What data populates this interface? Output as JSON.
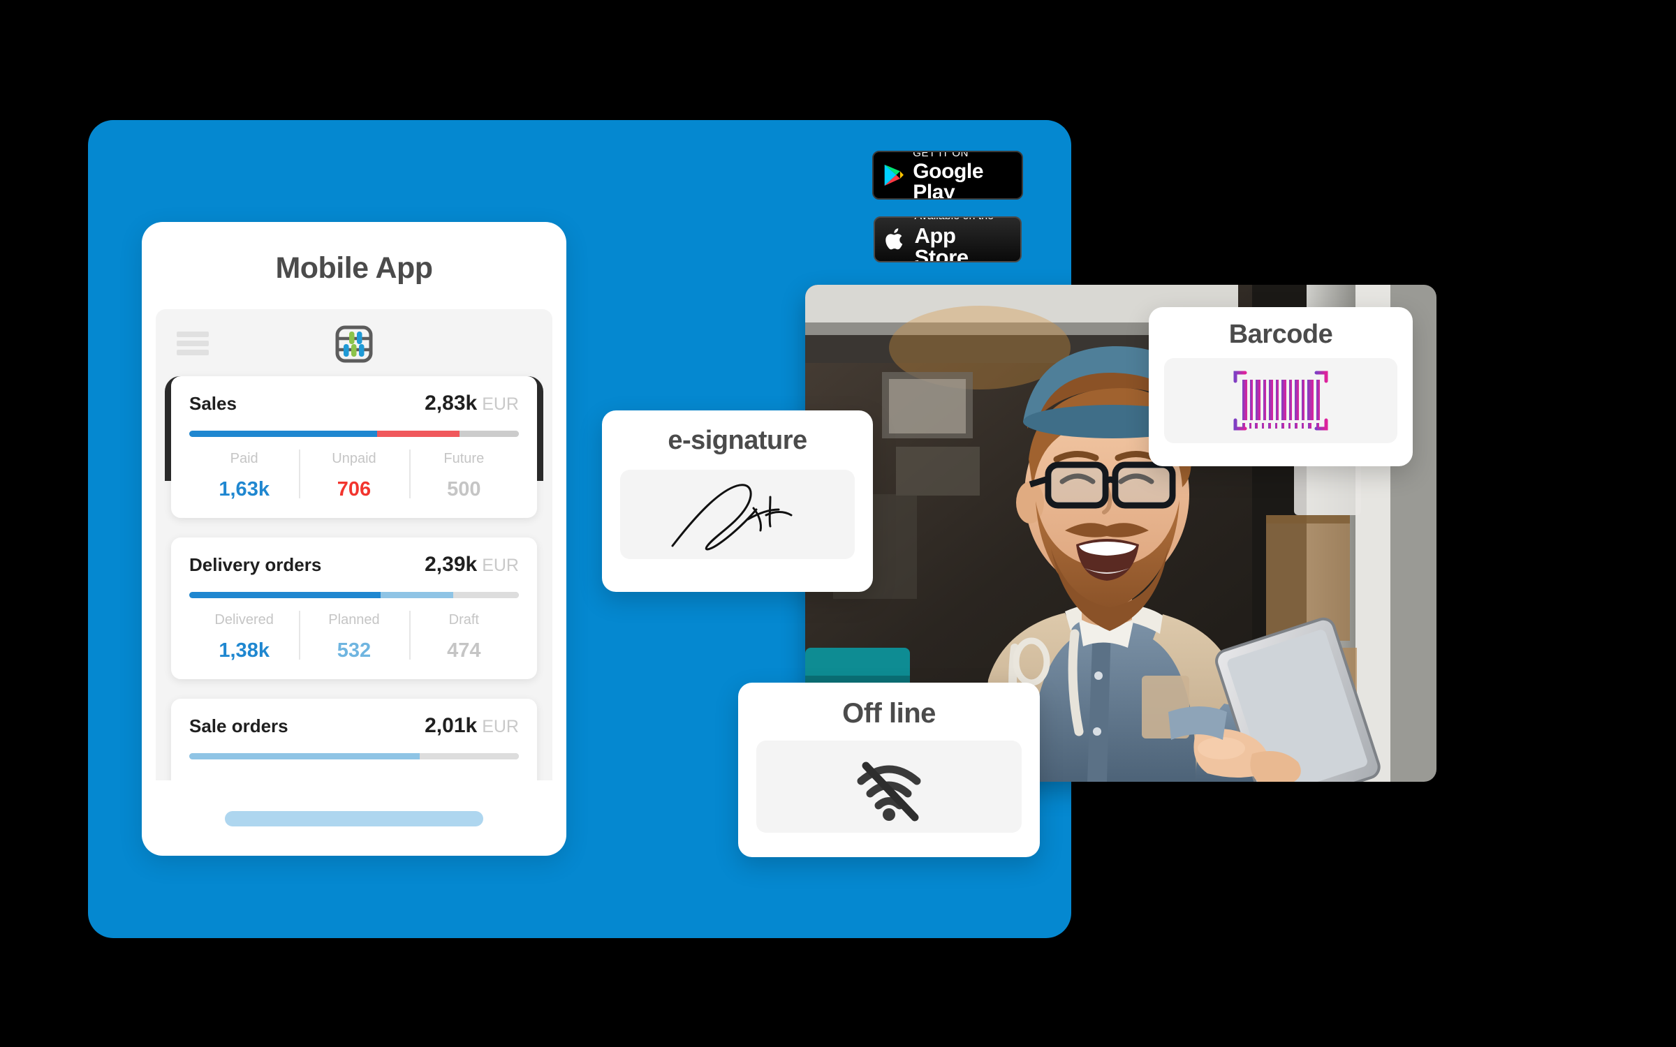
{
  "theme": {
    "panel_blue": "#0588d0",
    "accent_blue": "#1f87d0",
    "accent_red": "#f0585c",
    "accent_light_blue": "#8fc4e5",
    "track_gray": "#cccccc",
    "dark_band": "#2b2b2b"
  },
  "phone": {
    "title": "Mobile App",
    "menu_icon": "hamburger-icon",
    "app_icon": "abacus-app-icon",
    "home_indicator": "home-indicator",
    "cards": [
      {
        "name": "Sales",
        "amount": "2,83k",
        "currency": "EUR",
        "segments": [
          {
            "key": "paid",
            "pct": 57,
            "color": "#1f87d0"
          },
          {
            "key": "unpaid",
            "pct": 25,
            "color": "#f0585c"
          },
          {
            "key": "future",
            "pct": 18,
            "color": "#cccccc"
          }
        ],
        "stats": [
          {
            "label": "Paid",
            "value": "1,63k",
            "color": "#1f87d0"
          },
          {
            "label": "Unpaid",
            "value": "706",
            "color": "#f2352e"
          },
          {
            "label": "Future",
            "value": "500",
            "color": "#c5c5c5"
          }
        ]
      },
      {
        "name": "Delivery orders",
        "amount": "2,39k",
        "currency": "EUR",
        "segments": [
          {
            "key": "delivered",
            "pct": 58,
            "color": "#1f87d0"
          },
          {
            "key": "planned",
            "pct": 22,
            "color": "#8fc4e5"
          },
          {
            "key": "draft",
            "pct": 20,
            "color": "#dddddd"
          }
        ],
        "stats": [
          {
            "label": "Delivered",
            "value": "1,38k",
            "color": "#1f87d0"
          },
          {
            "label": "Planned",
            "value": "532",
            "color": "#6fb5e0"
          },
          {
            "label": "Draft",
            "value": "474",
            "color": "#c5c5c5"
          }
        ]
      },
      {
        "name": "Sale orders",
        "amount": "2,01k",
        "currency": "EUR",
        "segments": [
          {
            "key": "confirmed",
            "pct": 70,
            "color": "#8fc4e5"
          },
          {
            "key": "rest",
            "pct": 30,
            "color": "#dddddd"
          }
        ],
        "stats": []
      }
    ]
  },
  "store_badges": {
    "google_play": {
      "small": "GET IT ON",
      "big": "Google Play",
      "icon": "google-play-icon"
    },
    "app_store": {
      "small": "Available on the",
      "big": "App Store",
      "icon": "apple-logo-icon"
    }
  },
  "photo": {
    "alt": "Smiling bearded delivery driver with glasses and blue beanie holding a tablet inside a van"
  },
  "feature_cards": [
    {
      "id": "esignature",
      "title": "e-signature",
      "icon": "signature-icon"
    },
    {
      "id": "offline",
      "title": "Off line",
      "icon": "wifi-off-icon"
    },
    {
      "id": "barcode",
      "title": "Barcode",
      "icon": "barcode-scan-icon"
    }
  ]
}
